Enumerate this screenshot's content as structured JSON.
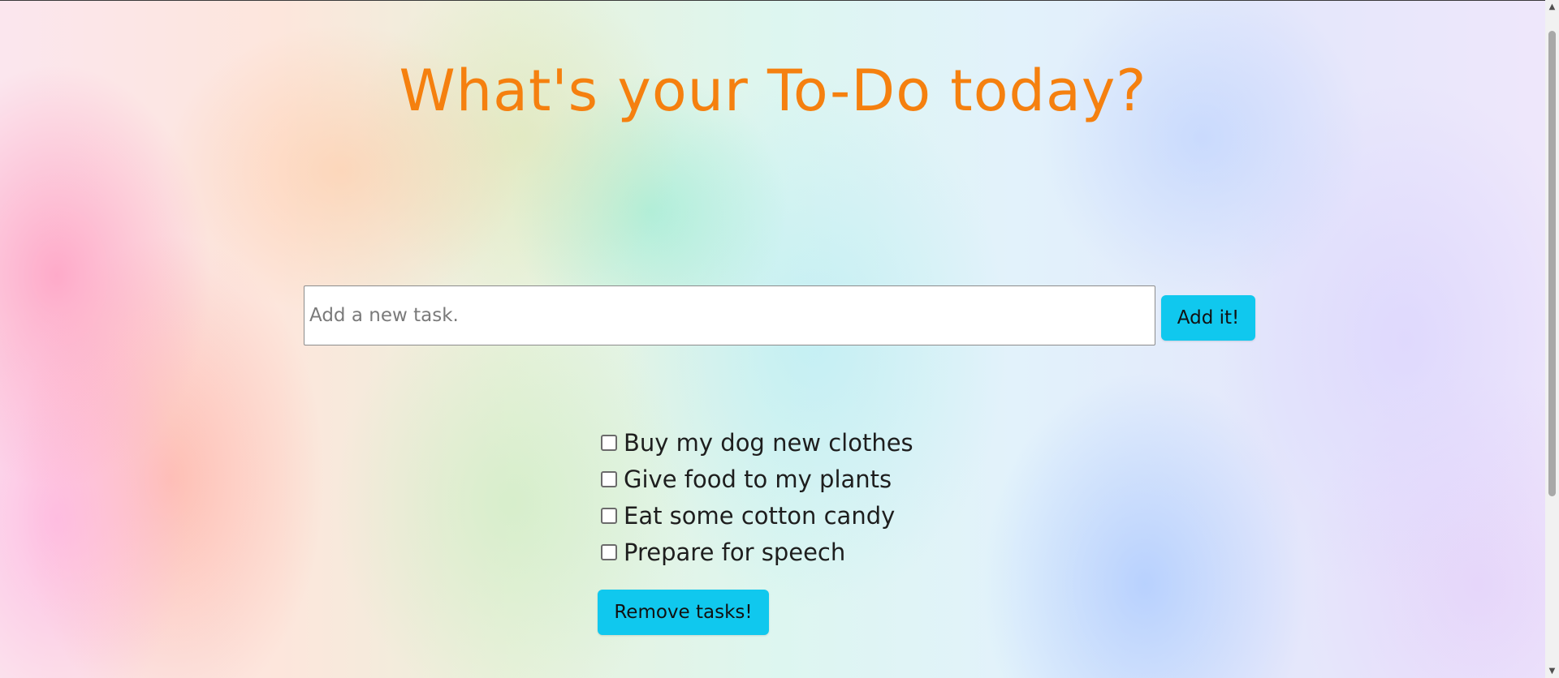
{
  "header": {
    "title": "What's your To-Do today?"
  },
  "new_task": {
    "value": "",
    "placeholder": "Add a new task.",
    "add_label": "Add it!"
  },
  "tasks": [
    {
      "label": "Buy my dog new clothes",
      "checked": false
    },
    {
      "label": "Give food to my plants",
      "checked": false
    },
    {
      "label": "Eat some cotton candy",
      "checked": false
    },
    {
      "label": "Prepare for speech",
      "checked": false
    }
  ],
  "actions": {
    "remove_label": "Remove tasks!"
  },
  "scrollbar": {
    "up_icon": "▲",
    "down_icon": "▼"
  },
  "colors": {
    "title": "#f5800f",
    "button": "#10c8ee"
  }
}
